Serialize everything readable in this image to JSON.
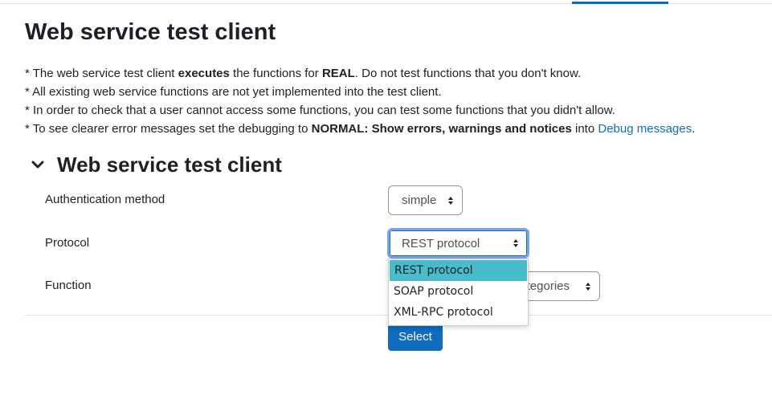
{
  "page": {
    "title": "Web service test client",
    "notes": [
      [
        {
          "t": "* The web service test client "
        },
        {
          "b": "executes"
        },
        {
          "t": " the functions for "
        },
        {
          "b": "REAL"
        },
        {
          "t": ". Do not test functions that you don't know."
        }
      ],
      [
        {
          "t": "* All existing web service functions are not yet implemented into the test client."
        }
      ],
      [
        {
          "t": "* In order to check that a user cannot access some functions, you can test some functions that you didn't allow."
        }
      ],
      [
        {
          "t": "* To see clearer error messages set the debugging to "
        },
        {
          "b": "NORMAL: Show errors, warnings and notices"
        },
        {
          "t": " into "
        },
        {
          "a": "Debug messages"
        },
        {
          "t": "."
        }
      ]
    ]
  },
  "section": {
    "title": "Web service test client",
    "toggle_icon": "chevron-down-icon"
  },
  "form": {
    "auth_label": "Authentication method",
    "auth_value": "simple",
    "protocol_label": "Protocol",
    "protocol_value": "REST protocol",
    "function_label": "Function",
    "function_value_visible": "tegories",
    "protocol_options": [
      "REST protocol",
      "SOAP protocol",
      "XML-RPC protocol"
    ],
    "submit_label": "Select"
  },
  "colors": {
    "accent": "#0f6cbf",
    "option_highlight": "#48bccb",
    "text": "#1d2125"
  }
}
